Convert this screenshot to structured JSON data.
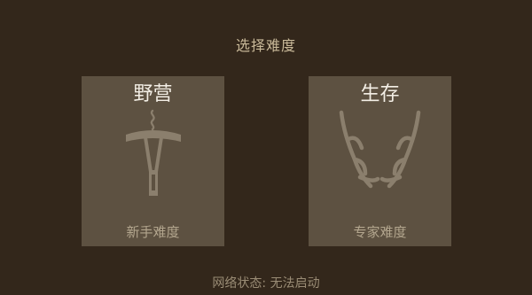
{
  "header": {
    "title": "选择难度"
  },
  "modes": [
    {
      "title": "野营",
      "subtitle": "新手难度",
      "icon": "roasting-spit-icon"
    },
    {
      "title": "生存",
      "subtitle": "专家难度",
      "icon": "antlers-icon"
    }
  ],
  "footer": {
    "network_status": "网络状态: 无法启动"
  },
  "colors": {
    "background": "#33271b",
    "card": "#5d5141",
    "title_text": "#c9b999",
    "card_title": "#f3eee5",
    "card_subtitle": "#b3a68e",
    "icon": "#8b7f6d"
  }
}
